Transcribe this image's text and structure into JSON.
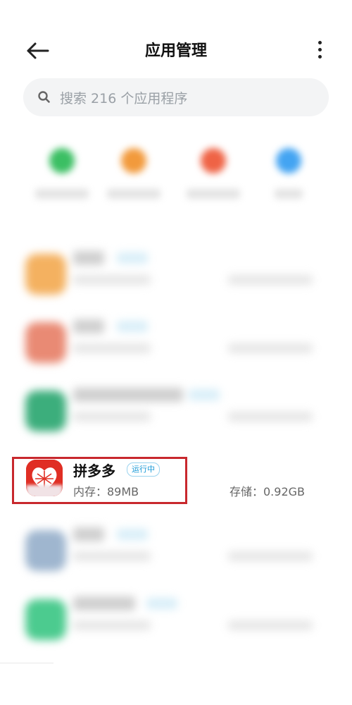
{
  "header": {
    "title": "应用管理"
  },
  "search": {
    "placeholder": "搜索 216 个应用程序"
  },
  "featured_app": {
    "name": "拼多多",
    "badge": "运行中",
    "memory": "内存：89MB",
    "storage": "存储：0.92GB"
  },
  "colors": {
    "accent_blue": "#1a9ad7",
    "highlight_red": "#c8282d",
    "pdd_red": "#e02e24"
  },
  "icons": [
    "back-arrow-icon",
    "more-vert-icon",
    "search-icon",
    "pinduoduo-app-icon"
  ]
}
